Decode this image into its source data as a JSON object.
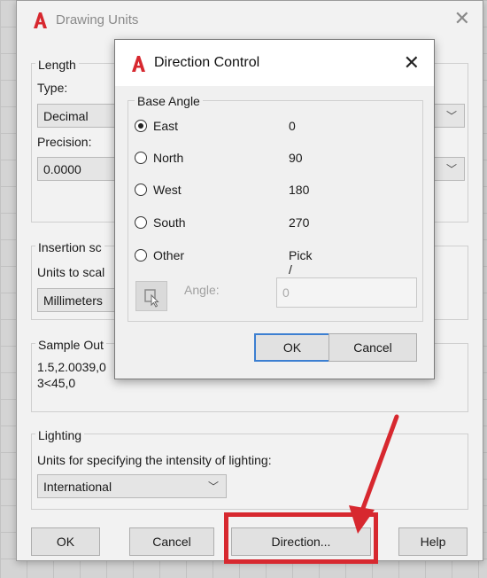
{
  "drawing_units": {
    "title": "Drawing Units",
    "close_glyph": "✕",
    "length": {
      "group_label": "Length",
      "type_label": "Type:",
      "type_value": "Decimal",
      "precision_label": "Precision:",
      "precision_value": "0.0000"
    },
    "insertion": {
      "group_label": "Insertion sc",
      "units_label": "Units to scal",
      "units_value": "Millimeters"
    },
    "sample": {
      "group_label": "Sample Out",
      "line1": "1.5,2.0039,0",
      "line2": "3<45,0"
    },
    "lighting": {
      "group_label": "Lighting",
      "desc": "Units for specifying the intensity of lighting:",
      "value": "International"
    },
    "buttons": {
      "ok": "OK",
      "cancel": "Cancel",
      "direction": "Direction...",
      "help": "Help"
    }
  },
  "direction_control": {
    "title": "Direction Control",
    "close_glyph": "✕",
    "base_angle_label": "Base Angle",
    "options": [
      {
        "label": "East",
        "value": "0",
        "selected": true
      },
      {
        "label": "North",
        "value": "90",
        "selected": false
      },
      {
        "label": "West",
        "value": "180",
        "selected": false
      },
      {
        "label": "South",
        "value": "270",
        "selected": false
      },
      {
        "label": "Other",
        "value": "Pick / Type",
        "selected": false
      }
    ],
    "angle_label": "Angle:",
    "angle_value": "0",
    "ok": "OK",
    "cancel": "Cancel"
  },
  "colors": {
    "autocad_red": "#d7282f",
    "highlight": "#d7282f",
    "arrow": "#d7282f"
  }
}
